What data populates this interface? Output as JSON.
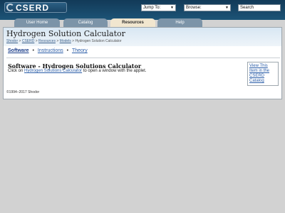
{
  "brand": {
    "logo_text": "CSERD"
  },
  "controls": {
    "jump_to": "Jump To:",
    "browse": "Browse:",
    "search": "Search",
    "dropdown_arrow": "▼"
  },
  "tabs": [
    {
      "label": "User Home"
    },
    {
      "label": "Catalog"
    },
    {
      "label": "Resources",
      "active": true
    },
    {
      "label": "Help"
    }
  ],
  "page": {
    "title": "Hydrogen Solution Calculator",
    "breadcrumb": {
      "items": [
        "Shodor",
        "CSERD",
        "Resources",
        "Models"
      ],
      "current": "Hydrogen Solution Calculator",
      "separator": ">"
    }
  },
  "subnav": {
    "items": [
      "Software",
      "Instructions",
      "Theory"
    ],
    "separator": "•"
  },
  "main": {
    "heading": "Software - Hydrogen Solutions Calculator",
    "instruction_prefix": "Click on",
    "instruction_link": "Hydrogen Solutions Calculator",
    "instruction_suffix": "to open a window with the applet.",
    "catalog_link": "View This Item in the CSERD Catalog"
  },
  "footer": {
    "copyright": "©1994–2017 Shodor"
  },
  "colors": {
    "topbar": "#1a4a6c",
    "tab_inactive": "#7c94a8",
    "tab_active": "#f1e6cf",
    "link": "#2a5da8",
    "header_band": "#dce9f4"
  }
}
